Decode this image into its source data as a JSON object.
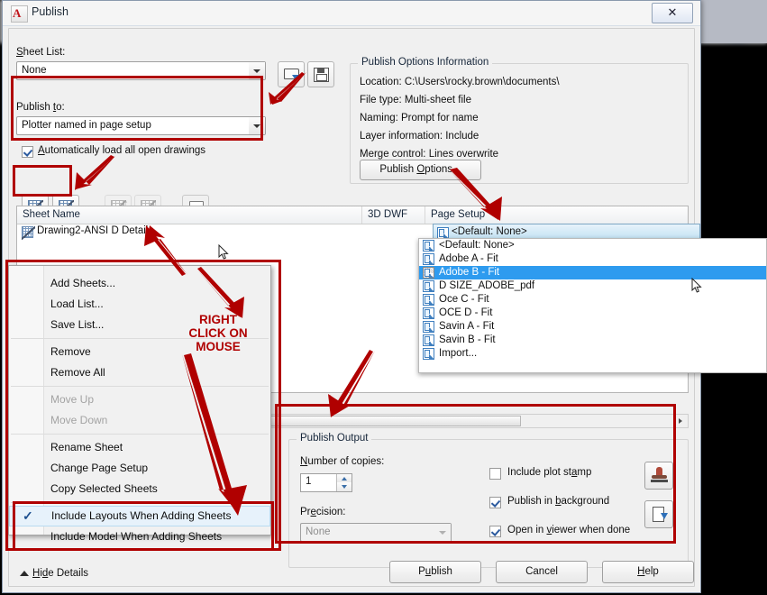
{
  "window": {
    "title": "Publish",
    "close_label": "✕",
    "app_icon": "A"
  },
  "sheet_list": {
    "label": "Sheet List:",
    "value": "None",
    "load_icon": "load-sheet-list-icon",
    "save_icon": "save-sheet-list-icon"
  },
  "publish_to": {
    "label": "Publish to:",
    "value": "Plotter named in page setup",
    "autoload_label": "Automatically load all open drawings",
    "autoload_checked": true
  },
  "toolbar": [
    {
      "name": "add-sheets-button",
      "icon": "sheet-plus-icon",
      "enabled": true
    },
    {
      "name": "remove-sheets-button",
      "icon": "sheet-minus-icon",
      "enabled": true
    },
    {
      "name": "move-sheet-up-button",
      "icon": "sheet-up-icon",
      "enabled": false
    },
    {
      "name": "move-sheet-down-button",
      "icon": "sheet-down-icon",
      "enabled": false
    },
    {
      "name": "preview-button",
      "icon": "preview-icon",
      "enabled": true
    }
  ],
  "publish_options_info": {
    "title": "Publish Options Information",
    "lines": [
      "Location: C:\\Users\\rocky.brown\\documents\\",
      "File type: Multi-sheet file",
      "Naming: Prompt for name",
      "Layer information: Include",
      "Merge control: Lines overwrite"
    ],
    "button_label": "Publish Options..."
  },
  "grid": {
    "columns": [
      "Sheet Name",
      "3D DWF",
      "Page Setup"
    ],
    "rows": [
      {
        "sheet_name": "Drawing2-ANSI D Detail",
        "dwf_3d": "",
        "page_setup": "<Default: None>"
      }
    ]
  },
  "page_setup_dropdown": {
    "selected": "Adobe B - Fit",
    "items": [
      "<Default: None>",
      "Adobe A - Fit",
      "Adobe B - Fit",
      "D SIZE_ADOBE_pdf",
      "Oce C - Fit",
      "OCE D - Fit",
      "Savin A - Fit",
      "Savin B - Fit",
      "Import..."
    ]
  },
  "context_menu": {
    "items": [
      {
        "label": "Add Sheets...",
        "enabled": true,
        "checked": false,
        "separator_after": false
      },
      {
        "label": "Load List...",
        "enabled": true,
        "checked": false,
        "separator_after": false
      },
      {
        "label": "Save List...",
        "enabled": true,
        "checked": false,
        "separator_after": true
      },
      {
        "label": "Remove",
        "enabled": true,
        "checked": false,
        "separator_after": false
      },
      {
        "label": "Remove All",
        "enabled": true,
        "checked": false,
        "separator_after": true
      },
      {
        "label": "Move Up",
        "enabled": false,
        "checked": false,
        "separator_after": false
      },
      {
        "label": "Move Down",
        "enabled": false,
        "checked": false,
        "separator_after": true
      },
      {
        "label": "Rename Sheet",
        "enabled": true,
        "checked": false,
        "separator_after": false
      },
      {
        "label": "Change Page Setup",
        "enabled": true,
        "checked": false,
        "separator_after": false
      },
      {
        "label": "Copy Selected Sheets",
        "enabled": true,
        "checked": false,
        "separator_after": true
      },
      {
        "label": "Include Layouts When Adding Sheets",
        "enabled": true,
        "checked": true,
        "separator_after": false
      },
      {
        "label": "Include Model When Adding Sheets",
        "enabled": true,
        "checked": false,
        "separator_after": false
      }
    ]
  },
  "publish_output": {
    "title": "Publish Output",
    "copies_label": "Number of copies:",
    "copies_value": "1",
    "precision_label": "Precision:",
    "precision_value": "None",
    "plot_stamp_label": "Include plot stamp",
    "plot_stamp_checked": false,
    "background_label": "Publish in background",
    "background_checked": true,
    "viewer_label": "Open in viewer when done",
    "viewer_checked": true,
    "stamp_icon": "plot-stamp-settings-icon",
    "export_icon": "save-sheet-list-export-icon"
  },
  "footer": {
    "hide_details": "Hide Details",
    "publish": "Publish",
    "cancel": "Cancel",
    "help": "Help"
  },
  "annotations": {
    "right_click_note": [
      "RIGHT",
      "CLICK ON",
      "MOUSE"
    ],
    "accent_color": "#b00000"
  }
}
